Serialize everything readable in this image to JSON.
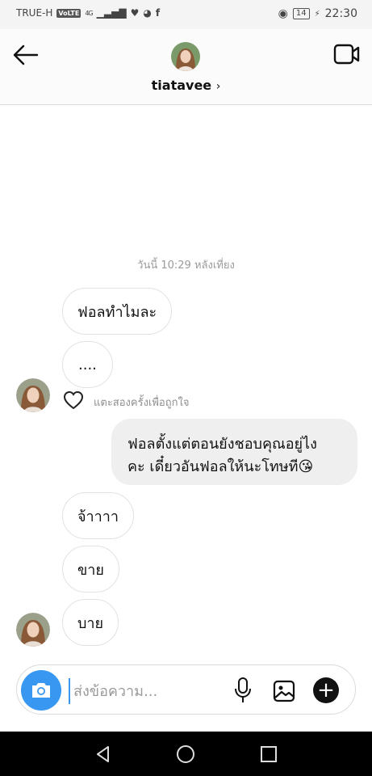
{
  "status_bar": {
    "carrier": "TRUE-H",
    "volte": "VoLTE",
    "network": "4G",
    "battery": "14",
    "time": "22:30"
  },
  "header": {
    "username": "tiatavee",
    "chevron": "›"
  },
  "chat": {
    "timestamp": "วันนี้ 10:29 หลังเที่ยง",
    "incoming_1": [
      "ฟอลทำไมละ",
      "...."
    ],
    "like_hint": "แตะสองครั้งเพื่อถูกใจ",
    "outgoing": {
      "line1": "ฟอลตั้งแต่ตอนยังชอบคุณอยู่ไง",
      "line2": "คะ เดี๋ยวอันฟอลให้นะโทษที",
      "emoji": "😘"
    },
    "incoming_2": [
      "จ้าาาา",
      "ขาย",
      "บาย"
    ]
  },
  "composer": {
    "placeholder": "ส่งข้อความ..."
  },
  "colors": {
    "accent": "#3897f0",
    "bubble_out": "#efefef",
    "timestamp": "#9a9a9a"
  },
  "icons": [
    "back-arrow-icon",
    "video-call-icon",
    "camera-icon",
    "mic-icon",
    "gallery-icon",
    "plus-icon",
    "heart-icon",
    "nav-back-icon",
    "nav-home-icon",
    "nav-recent-icon"
  ]
}
